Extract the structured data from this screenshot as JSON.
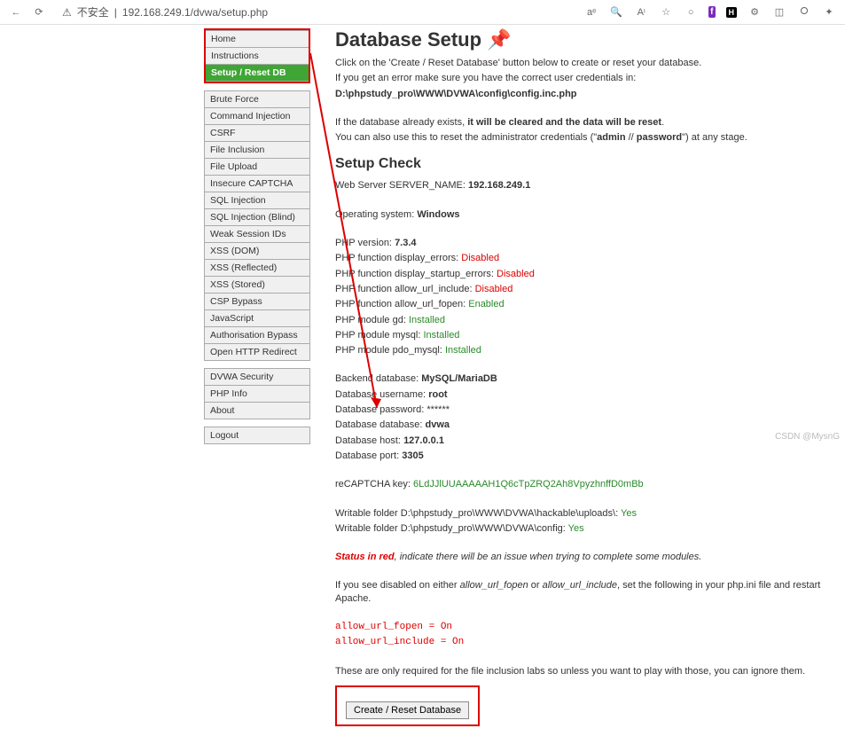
{
  "toolbar": {
    "security_label": "不安全",
    "url": "192.168.249.1/dvwa/setup.php"
  },
  "sidebar": {
    "group1": [
      "Home",
      "Instructions",
      "Setup / Reset DB"
    ],
    "group2": [
      "Brute Force",
      "Command Injection",
      "CSRF",
      "File Inclusion",
      "File Upload",
      "Insecure CAPTCHA",
      "SQL Injection",
      "SQL Injection (Blind)",
      "Weak Session IDs",
      "XSS (DOM)",
      "XSS (Reflected)",
      "XSS (Stored)",
      "CSP Bypass",
      "JavaScript",
      "Authorisation Bypass",
      "Open HTTP Redirect"
    ],
    "group3": [
      "DVWA Security",
      "PHP Info",
      "About"
    ],
    "group4": [
      "Logout"
    ],
    "active": "Setup / Reset DB"
  },
  "setup": {
    "title": "Database Setup",
    "intro1": "Click on the 'Create / Reset Database' button below to create or reset your database.",
    "intro2": "If you get an error make sure you have the correct user credentials in:",
    "config_path": "D:\\phpstudy_pro\\WWW\\DVWA\\config\\config.inc.php",
    "warn_prefix": "If the database already exists,",
    "warn_bold": "it will be cleared and the data will be reset",
    "warn2_prefix": "You can also use this to reset the administrator credentials (\"",
    "warn2_admin": "admin",
    "warn2_sep": " // ",
    "warn2_pass": "password",
    "warn2_suffix": "\") at any stage.",
    "check_title": "Setup Check",
    "server_label": "Web Server SERVER_NAME:",
    "server_value": "192.168.249.1",
    "os_label": "Operating system:",
    "os_value": "Windows",
    "php_version_label": "PHP version:",
    "php_version_value": "7.3.4",
    "display_errors_label": "PHP function display_errors:",
    "display_errors_value": "Disabled",
    "startup_errors_label": "PHP function display_startup_errors:",
    "startup_errors_value": "Disabled",
    "url_include_label": "PHP function allow_url_include:",
    "url_include_value": "Disabled",
    "url_fopen_label": "PHP function allow_url_fopen:",
    "url_fopen_value": "Enabled",
    "gd_label": "PHP module gd:",
    "gd_value": "Installed",
    "mysql_label": "PHP module mysql:",
    "mysql_value": "Installed",
    "pdo_label": "PHP module pdo_mysql:",
    "pdo_value": "Installed",
    "backend_label": "Backend database:",
    "backend_value": "MySQL/MariaDB",
    "db_user_label": "Database username:",
    "db_user_value": "root",
    "db_pass_label": "Database password:",
    "db_pass_value": "******",
    "db_name_label": "Database database:",
    "db_name_value": "dvwa",
    "db_host_label": "Database host:",
    "db_host_value": "127.0.0.1",
    "db_port_label": "Database port:",
    "db_port_value": "3305",
    "recaptcha_label": "reCAPTCHA key:",
    "recaptcha_value": "6LdJJlUUAAAAAH1Q6cTpZRQ2Ah8VpyzhnffD0mBb",
    "folder1_label": "Writable folder D:\\phpstudy_pro\\WWW\\DVWA\\hackable\\uploads\\:",
    "folder1_value": "Yes",
    "folder2_label": "Writable folder D:\\phpstudy_pro\\WWW\\DVWA\\config:",
    "folder2_value": "Yes",
    "status_label": "Status in red",
    "status_text": ", indicate there will be an issue when trying to complete some modules.",
    "disabled_note_1": "If you see disabled on either ",
    "disabled_note_i1": "allow_url_fopen",
    "disabled_note_2": " or ",
    "disabled_note_i2": "allow_url_include",
    "disabled_note_3": ", set the following in your php.ini file and restart Apache.",
    "code1": "allow_url_fopen = On",
    "code2": "allow_url_include = On",
    "final_note": "These are only required for the file inclusion labs so unless you want to play with those, you can ignore them.",
    "button_label": "Create / Reset Database"
  },
  "watermark": "CSDN @MysnG"
}
